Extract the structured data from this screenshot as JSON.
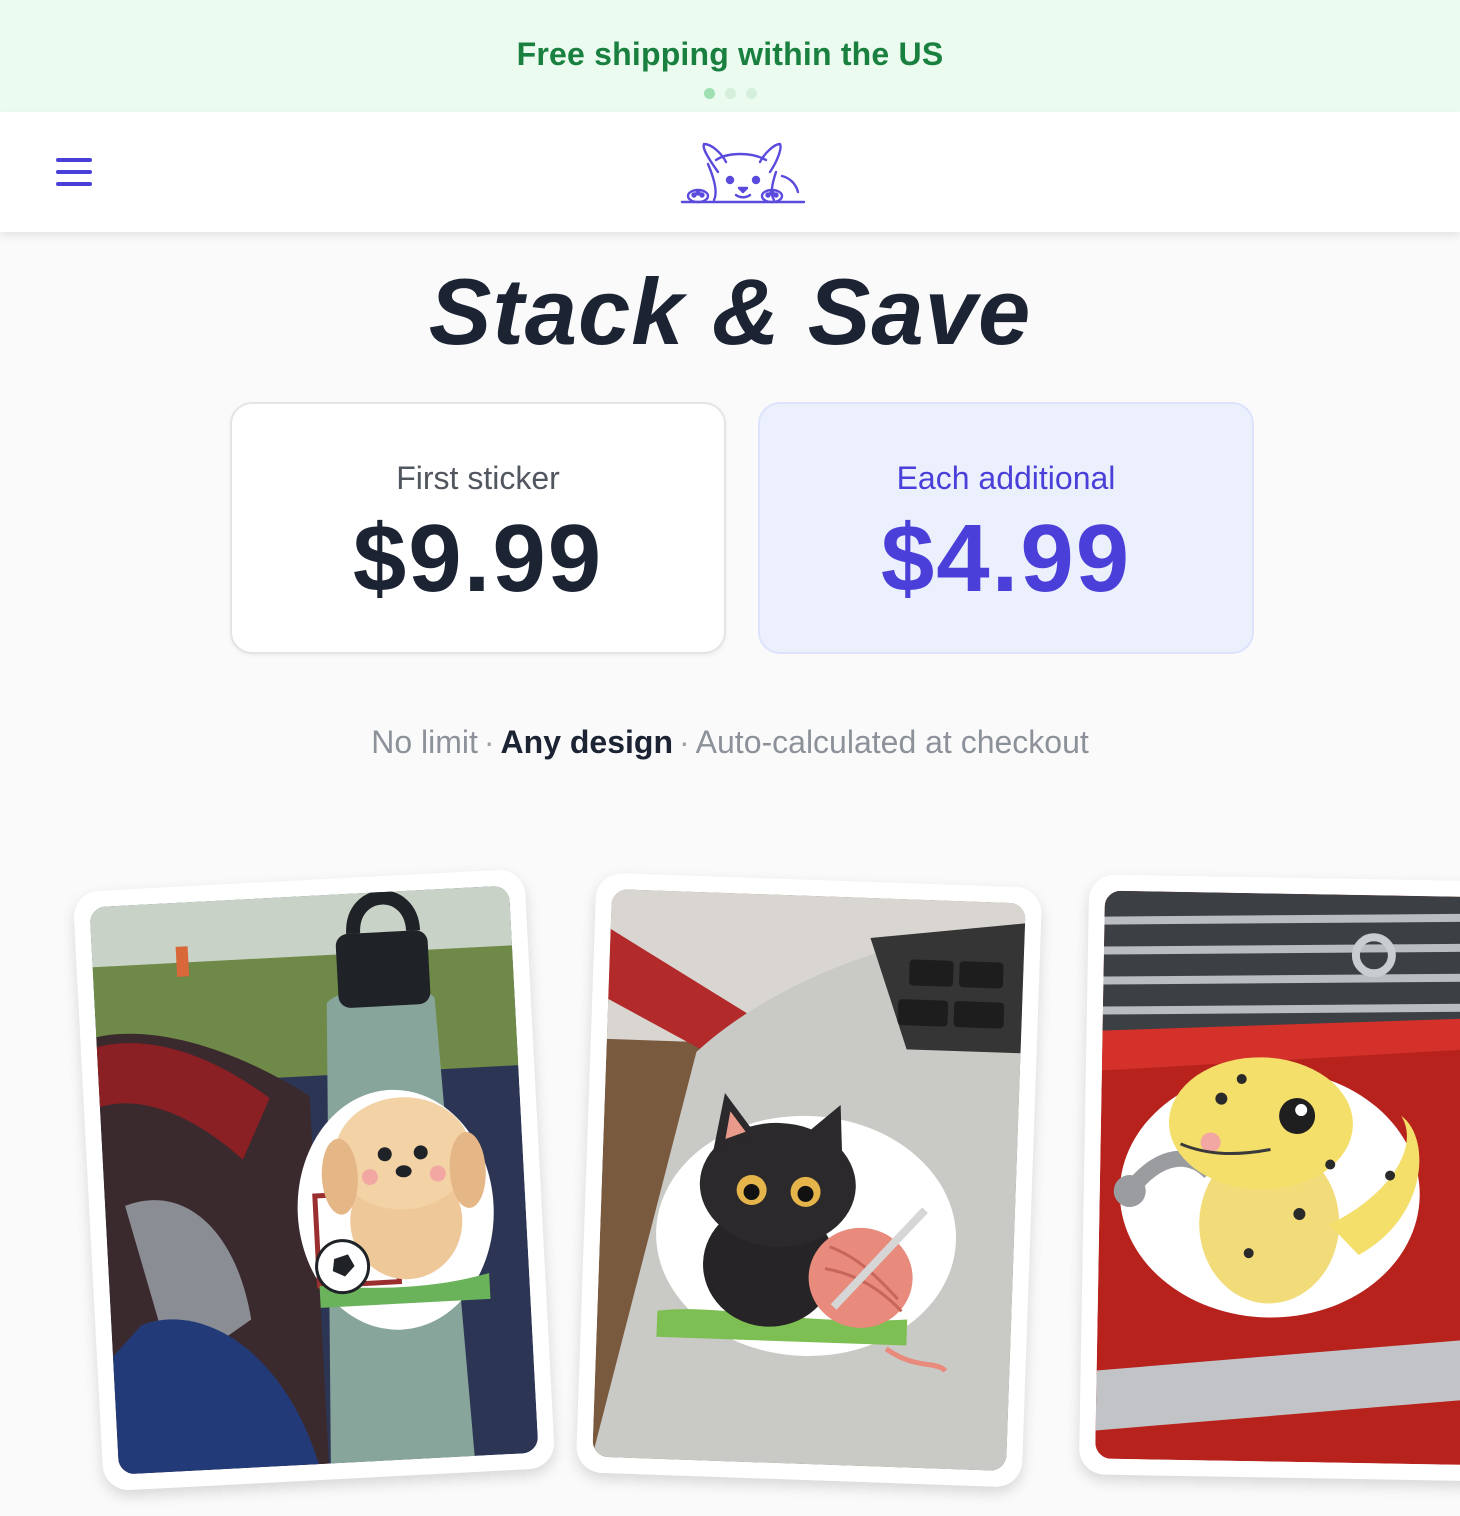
{
  "announcement": {
    "text": "Free shipping within the US",
    "slides": 3,
    "active_slide": 1
  },
  "header": {
    "menu_icon": "hamburger-menu-icon",
    "logo_icon": "corgi-logo-icon"
  },
  "hero": {
    "title": "Stack & Save"
  },
  "pricing": {
    "first": {
      "label": "First sticker",
      "price": "$9.99"
    },
    "additional": {
      "label": "Each additional",
      "price": "$4.99"
    }
  },
  "notes": {
    "item1": "No limit",
    "item2": "Any design",
    "item3": "Auto-calculated at checkout",
    "separator": "·"
  },
  "gallery": {
    "items": [
      {
        "subject": "puppy-soccer-sticker-on-water-bottle"
      },
      {
        "subject": "black-cat-yarn-sticker-on-laptop"
      },
      {
        "subject": "gecko-wrench-sticker-on-toolbox"
      }
    ]
  },
  "colors": {
    "accent": "#4a3fd8",
    "announcement_bg": "#ebfbef",
    "announcement_text": "#19803f",
    "headline": "#1c2333",
    "additional_card_bg": "#ecf0fd"
  }
}
